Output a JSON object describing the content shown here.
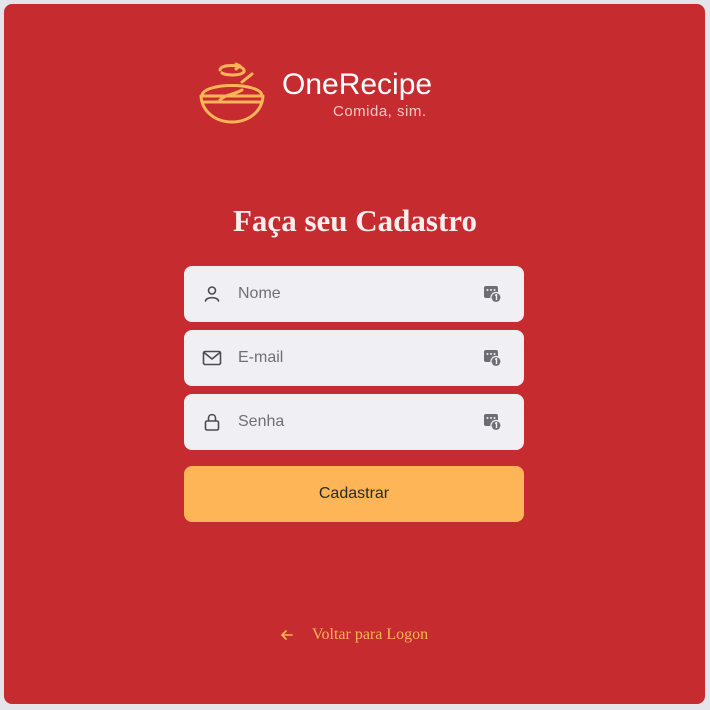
{
  "brand": {
    "name": "OneRecipe",
    "tagline": "Comida, sim."
  },
  "form": {
    "title": "Faça seu Cadastro",
    "fields": [
      {
        "placeholder": "Nome",
        "value": "",
        "icon": "user-icon"
      },
      {
        "placeholder": "E-mail",
        "value": "",
        "icon": "mail-icon"
      },
      {
        "placeholder": "Senha",
        "value": "",
        "icon": "lock-icon"
      }
    ],
    "submit_label": "Cadastrar",
    "back_label": "Voltar para Logon"
  },
  "colors": {
    "background": "#c62b2f",
    "accent": "#fdb557",
    "field_bg": "#f0eff4",
    "page_bg": "#e4e4ea"
  },
  "icons": {
    "logo": "bowl-whisk-logo",
    "field_autofill": "password-manager-icon",
    "back": "arrow-left-icon"
  }
}
